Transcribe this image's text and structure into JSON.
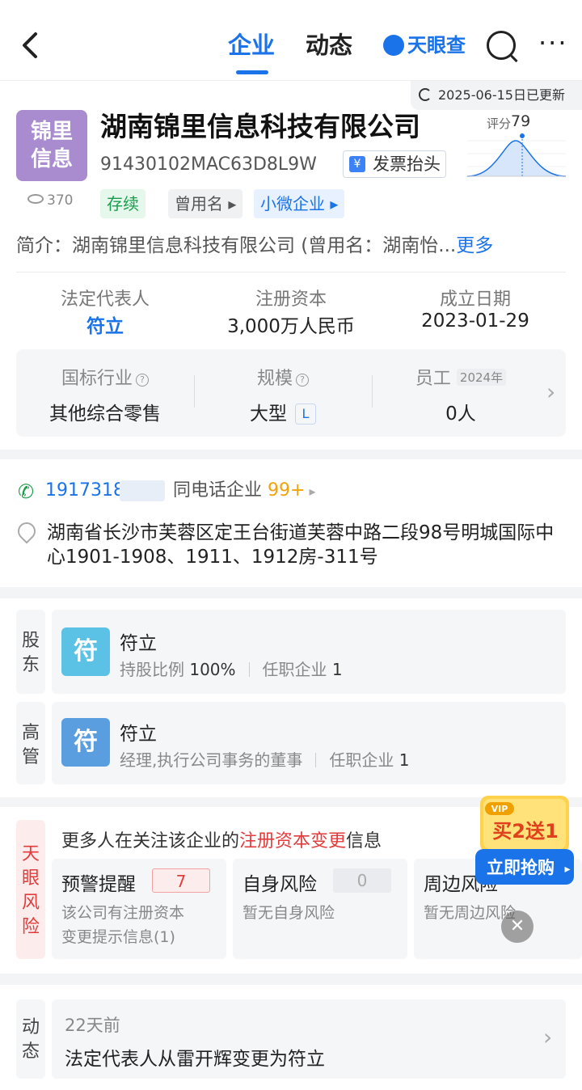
{
  "nav": {
    "back": "‹",
    "tabs": [
      "企业",
      "动态"
    ],
    "brand": "天眼查"
  },
  "company": {
    "updated": "2025-06-15日已更新",
    "logo_line1": "锦里",
    "logo_line2": "信息",
    "name": "湖南锦里信息科技有限公司",
    "credit_code": "91430102MAC63D8L9W",
    "invoice_label": "发票抬头",
    "score_label": "评分",
    "score": "79",
    "views": "370",
    "tags": [
      "存续",
      "曾用名 ▸",
      "小微企业 ▸"
    ],
    "intro_label": "简介：",
    "intro": "湖南锦里信息科技有限公司 (曾用名：湖南怡...",
    "intro_more": "更多"
  },
  "stats": [
    {
      "label": "法定代表人",
      "value": "符立"
    },
    {
      "label": "注册资本",
      "value": "3,000万人民币"
    },
    {
      "label": "成立日期",
      "value": "2023-01-29"
    }
  ],
  "industry": {
    "industry_label": "国标行业",
    "industry_value": "其他综合零售",
    "scale_label": "规模",
    "scale_value": "大型",
    "scale_badge": "L",
    "staff_label": "员工",
    "staff_year": "2024年",
    "staff_value": "0人"
  },
  "contact": {
    "phone": "1917318",
    "same_phone_label": "同电话企业",
    "same_phone_count": "99+",
    "address": "湖南省长沙市芙蓉区定王台街道芙蓉中路二段98号明城国际中心1901-1908、1911、1912房-311号"
  },
  "shareholder": {
    "side": [
      "股",
      "东"
    ],
    "avatar": "符",
    "name": "符立",
    "ratio_label": "持股比例",
    "ratio": "100%",
    "positions_label": "任职企业",
    "positions": "1"
  },
  "executive": {
    "side": [
      "高",
      "管"
    ],
    "avatar": "符",
    "name": "符立",
    "role": "经理,执行公司事务的董事",
    "positions_label": "任职企业",
    "positions": "1"
  },
  "risk": {
    "side": [
      "天",
      "眼",
      "风",
      "险"
    ],
    "note_pre": "更多人在关注该企业的",
    "note_red": "注册资本变更",
    "note_post": "信息",
    "items": [
      {
        "title": "预警提醒",
        "count": "7",
        "desc1": "该公司有注册资本",
        "desc2": "变更提示信息(1)"
      },
      {
        "title": "自身风险",
        "count": "0",
        "desc1": "暂无自身风险",
        "desc2": ""
      },
      {
        "title": "周边风险",
        "count": "",
        "desc1": "暂无周边风险",
        "desc2": ""
      }
    ],
    "promo_vip": "VIP",
    "promo_offer": "买2送1",
    "promo_cta": "立即抢购"
  },
  "news": {
    "side": [
      "动",
      "态"
    ],
    "time": "22天前",
    "text": "法定代表人从雷开辉变更为符立"
  },
  "colors": {
    "accent": "#1a73e8",
    "green": "#1a9c4c",
    "red": "#e23b3b",
    "orange": "#f2a20a"
  }
}
